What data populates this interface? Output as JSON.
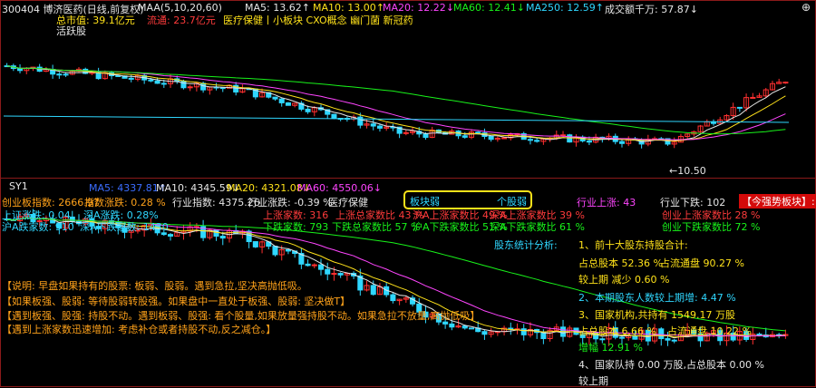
{
  "colors": {
    "up": "#ff3030",
    "down": "#2fd7ff",
    "ma5": "#e6e6e6",
    "ma10": "#ffe21a",
    "ma20": "#ff45ff",
    "ma60": "#18f21a",
    "ma250": "#2fd7ff",
    "bg": "#000000",
    "grid": "#8b1a1a"
  },
  "top": {
    "stock_title": "300404 博济医药(日线,前复权)",
    "indicator_name": "MAA(5,10,20,60)",
    "ma5": "MA5: 13.62↑",
    "ma10": "MA10: 13.00↑",
    "ma20": "MA20: 12.22↓",
    "ma60": "MA60: 12.41↓",
    "ma250": "MA250: 12.59↑",
    "volume": "成交额千万: 57.87↓",
    "market_cap": "总市值: 39.1亿元",
    "float_cap": "流通: 23.7亿元",
    "concepts": "医疗保健丨小板块 CXO概念 幽门菌 新冠药",
    "activity": "活跃股",
    "low_label": "10.50",
    "collapse_icon": "plus-minus-icon"
  },
  "bottom": {
    "indicator": "SY1",
    "ma5": "MA5: 4337.81↑",
    "ma10": "MA10: 4345.59↓",
    "ma20": "MA20: 4321.08↓",
    "ma60": "MA60: 4550.06↓",
    "row1": {
      "board_index": "创业板指数: 2666.97",
      "index_change": "指数涨跌: 0.28 %",
      "industry_index": "行业指数: 4375.26",
      "industry_change": "行业涨跌: -0.39 %",
      "industry_name": "医疗保健",
      "board_weak": "板块弱",
      "stock_weak": "个股弱",
      "industry_up": "行业上涨: 43",
      "industry_down": "行业下跌: 102",
      "strong_block": "【今强势板块】:"
    },
    "row2": {
      "sh_change": "上证涨跌: 0.04",
      "sz_change": "深A涨跌: 0.28%",
      "up_count": "上涨家数: 316",
      "up_ratio": "上涨总家数比 43 %",
      "hs_up_ratio": "沪A上涨家数比 49 %",
      "sz_up_ratio": "深A上涨家数比 39 %",
      "cy_up_ratio": "创业上涨家数比 28 %"
    },
    "row3": {
      "sh_down": "沪A跌家数: 910",
      "sz_down": "深A下跌家数: 1430",
      "down_count": "下跌家数: 793",
      "down_ratio": "下跌总家数比 57 %",
      "hs_down_ratio": "沪A下跌家数比 51 %",
      "sz_down_ratio": "深A下跌家数比 61 %",
      "cy_down_ratio": "创业下跌家数比 72 %"
    },
    "notes": [
      "【说明: 早盘如果持有的股票: 板弱、股弱。遇到急拉,坚决高抛低吸。",
      "【如果板强、股弱: 等待股弱转股强。如果盘中一直处于板强、股弱: 坚决做T】",
      "【遇到板强、股强: 持股不动。遇到板弱、股强: 看个股量,如果放量强持股不动。如果急拉不放量,高抛低吸】",
      "【遇到上涨家数迅速增加: 考虑补仓或者持股不动,反之减仓。】"
    ],
    "holders": {
      "title": "股东统计分析:",
      "item1": "1、前十大股东持股合计:",
      "total_share": "占总股本 52.36 %",
      "float_share": "占流通盘 90.27 %",
      "trend1": "较上期 减少 0.60 %",
      "item2": "2、本期股东人数较上期增: 4.47 %",
      "item3": "3、国家机构,共持有 1549.17 万股",
      "inst_total": "占总股本 6.66 %",
      "inst_float": "占流通盘 10.22 %",
      "growth": "增幅 12.91 %",
      "item4": "4、国家队持 0.00 万股,占总股本 0.00 %",
      "trend4": "较上期"
    }
  }
}
